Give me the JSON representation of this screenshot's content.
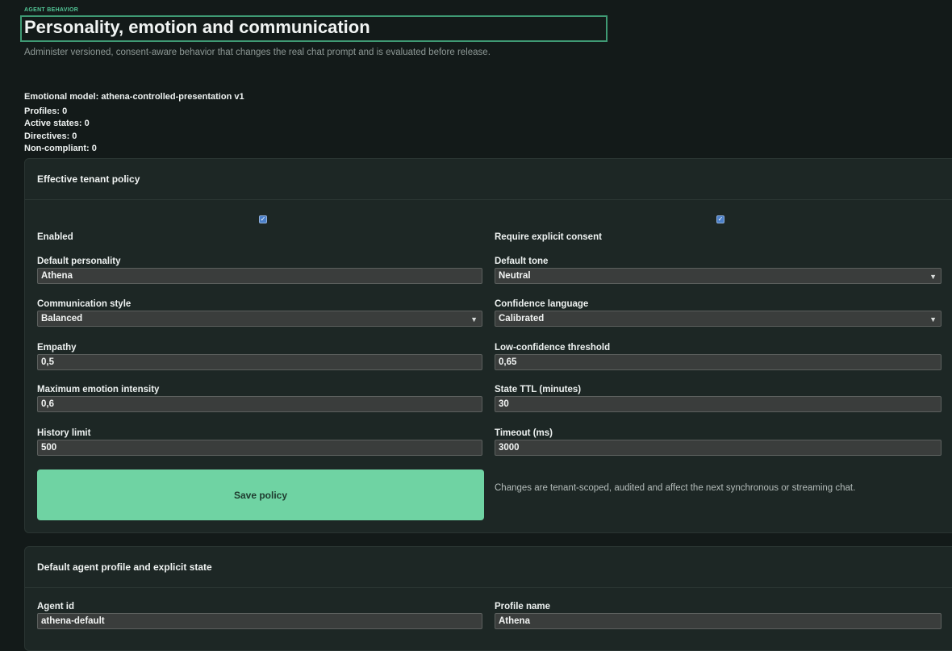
{
  "header": {
    "eyebrow": "AGENT BEHAVIOR",
    "title": "Personality, emotion and communication",
    "subtitle": "Administer versioned, consent-aware behavior that changes the real chat prompt and is evaluated before release."
  },
  "metrics": {
    "emotional_model": "Emotional model: athena-controlled-presentation v1",
    "profiles": "Profiles: 0",
    "active_states": "Active states: 0",
    "directives": "Directives: 0",
    "non_compliant": "Non-compliant: 0"
  },
  "policy": {
    "heading": "Effective tenant policy",
    "enabled": {
      "label": "Enabled",
      "checked": true
    },
    "require_consent": {
      "label": "Require explicit consent",
      "checked": true
    },
    "default_personality": {
      "label": "Default personality",
      "value": "Athena"
    },
    "default_tone": {
      "label": "Default tone",
      "value": "Neutral"
    },
    "communication_style": {
      "label": "Communication style",
      "value": "Balanced"
    },
    "confidence_language": {
      "label": "Confidence language",
      "value": "Calibrated"
    },
    "empathy": {
      "label": "Empathy",
      "value": "0,5"
    },
    "low_confidence_threshold": {
      "label": "Low-confidence threshold",
      "value": "0,65"
    },
    "max_emotion_intensity": {
      "label": "Maximum emotion intensity",
      "value": "0,6"
    },
    "state_ttl": {
      "label": "State TTL (minutes)",
      "value": "30"
    },
    "history_limit": {
      "label": "History limit",
      "value": "500"
    },
    "timeout": {
      "label": "Timeout (ms)",
      "value": "3000"
    },
    "save_label": "Save policy",
    "note": "Changes are tenant-scoped, audited and affect the next synchronous or streaming chat."
  },
  "profile": {
    "heading": "Default agent profile and explicit state",
    "agent_id": {
      "label": "Agent id",
      "value": "athena-default"
    },
    "profile_name": {
      "label": "Profile name",
      "value": "Athena"
    }
  },
  "colors": {
    "background": "#131a19",
    "panel": "#1d2725",
    "accent": "#6fd3a3",
    "eyebrow": "#53c898",
    "checkbox": "#4b7fc8"
  },
  "icons": {
    "select": "chevron-down-icon",
    "checkbox": "check-icon"
  }
}
